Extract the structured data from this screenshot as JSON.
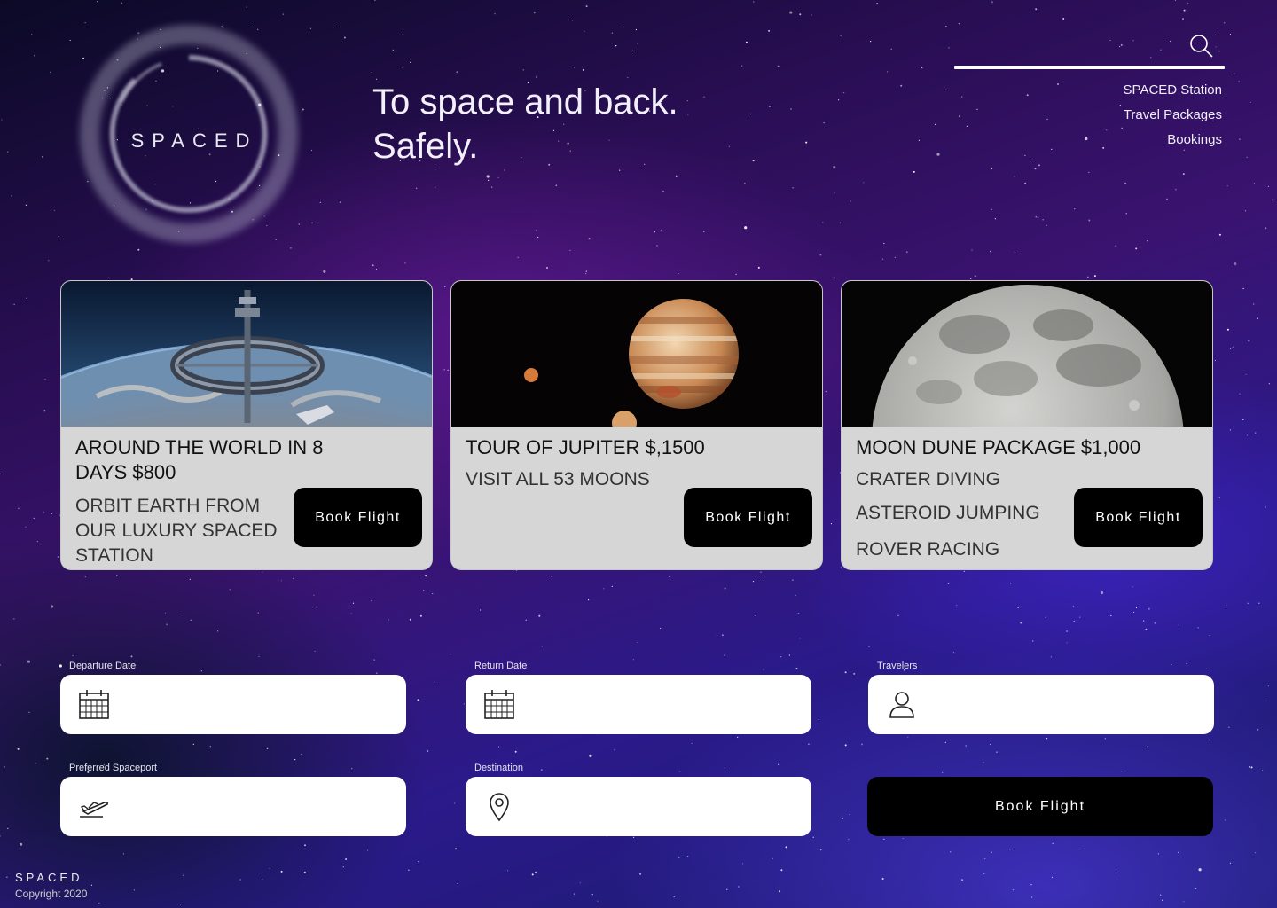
{
  "brand": {
    "name": "SPACED"
  },
  "hero": {
    "line1": "To space and back.",
    "line2": "Safely."
  },
  "header": {
    "search_icon": "search-icon",
    "nav": [
      "SPACED Station",
      "Travel Packages",
      "Bookings"
    ]
  },
  "cards": [
    {
      "title": "AROUND THE WORLD IN 8 DAYS $800",
      "lines": [
        "ORBIT EARTH FROM OUR LUXURY SPACED STATION"
      ],
      "button": "Book Flight",
      "image": "space-station-over-earth"
    },
    {
      "title": "TOUR OF JUPITER $,1500",
      "lines": [
        "VISIT ALL 53 MOONS"
      ],
      "button": "Book Flight",
      "image": "jupiter-with-moons"
    },
    {
      "title": "MOON DUNE PACKAGE $1,000",
      "lines": [
        "CRATER DIVING",
        "ASTEROID JUMPING",
        "ROVER RACING"
      ],
      "button": "Book Flight",
      "image": "moon"
    }
  ],
  "form": {
    "departure": {
      "label": "Departure Date",
      "value": "",
      "icon": "calendar-icon"
    },
    "return": {
      "label": "Return Date",
      "value": "",
      "icon": "calendar-icon"
    },
    "travelers": {
      "label": "Travelers",
      "value": "",
      "icon": "user-icon"
    },
    "spaceport": {
      "label": "Preferred Spaceport",
      "value": "",
      "icon": "airplane-takeoff-icon"
    },
    "destination": {
      "label": "Destination",
      "value": "",
      "icon": "location-pin-icon"
    },
    "submit": "Book Flight"
  },
  "footer": {
    "brand": "SPACED",
    "copyright": "Copyright 2020"
  },
  "colors": {
    "button": "#000000",
    "card_bg": "#d6d6d6",
    "field_bg": "#ffffff"
  }
}
